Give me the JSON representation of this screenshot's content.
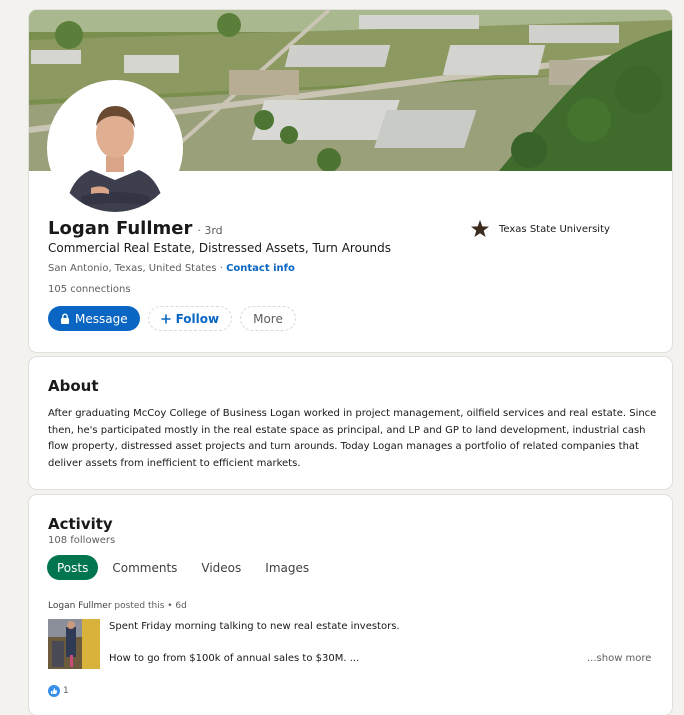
{
  "profile": {
    "name": "Logan Fullmer",
    "degree": "· 3rd",
    "headline": "Commercial Real Estate, Distressed Assets, Turn Arounds",
    "location": "San Antonio, Texas, United States",
    "separator": " · ",
    "contact_label": "Contact info",
    "connections": "105 connections",
    "school": "Texas State University",
    "buttons": {
      "message": "Message",
      "follow": "Follow",
      "more": "More"
    }
  },
  "about": {
    "title": "About",
    "text": "After graduating McCoy College of Business Logan worked in project management, oilfield services and real estate. Since then, he's participated mostly in the real estate space as principal, and LP and GP to land development, industrial cash flow property, distressed asset projects and turn arounds. Today Logan manages a portfolio of related companies that deliver assets from inefficient to efficient markets."
  },
  "activity": {
    "title": "Activity",
    "followers": "108 followers",
    "tabs": [
      "Posts",
      "Comments",
      "Videos",
      "Images"
    ],
    "post": {
      "author": "Logan Fullmer",
      "meta": " posted this • 6d",
      "line1": "Spent Friday morning talking to new real estate investors.",
      "line2": "How to go from $100k of annual sales to $30M. ...",
      "show_more": "...show more",
      "reaction_count": "1"
    }
  },
  "colors": {
    "primary_blue": "#0a66c2",
    "active_tab_green": "#01754f",
    "page_bg": "#f3f2ef"
  }
}
